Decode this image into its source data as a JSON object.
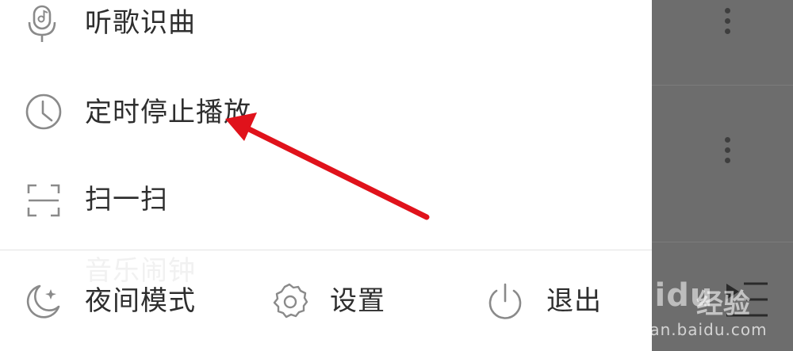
{
  "menu": {
    "items": [
      {
        "label": "听歌识曲",
        "icon": "microphone-icon"
      },
      {
        "label": "定时停止播放",
        "icon": "clock-icon"
      },
      {
        "label": "扫一扫",
        "icon": "scan-icon"
      }
    ],
    "ghost_label": "音乐闹钟"
  },
  "bottom_bar": {
    "night_mode_label": "夜间模式",
    "settings_label": "设置",
    "exit_label": "退出"
  },
  "watermark": {
    "logo_text": "Baidu",
    "brand_text": "经验",
    "url_text": "jingyan.baidu.com"
  },
  "colors": {
    "drawer_bg": "#ffffff",
    "text": "#2e2e2e",
    "icon": "#8a8a8a",
    "arrow": "#e0121b",
    "backdrop": "#6d6d6d"
  }
}
